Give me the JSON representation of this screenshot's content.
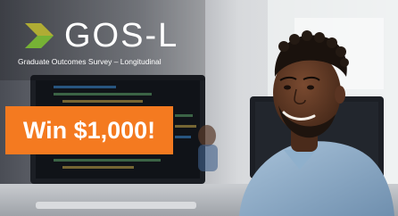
{
  "brand": {
    "name": "GOS-L",
    "subtitle": "Graduate Outcomes Survey – Longitudinal",
    "accent_color": "#f47a20",
    "logo_mark_color": "#8dc63f",
    "logo_mark_shadow_color": "#5a9a2a"
  },
  "promo": {
    "cta_label": "Win $1,000!"
  },
  "photo": {
    "icon": "smiling-man-at-computer-photo"
  }
}
